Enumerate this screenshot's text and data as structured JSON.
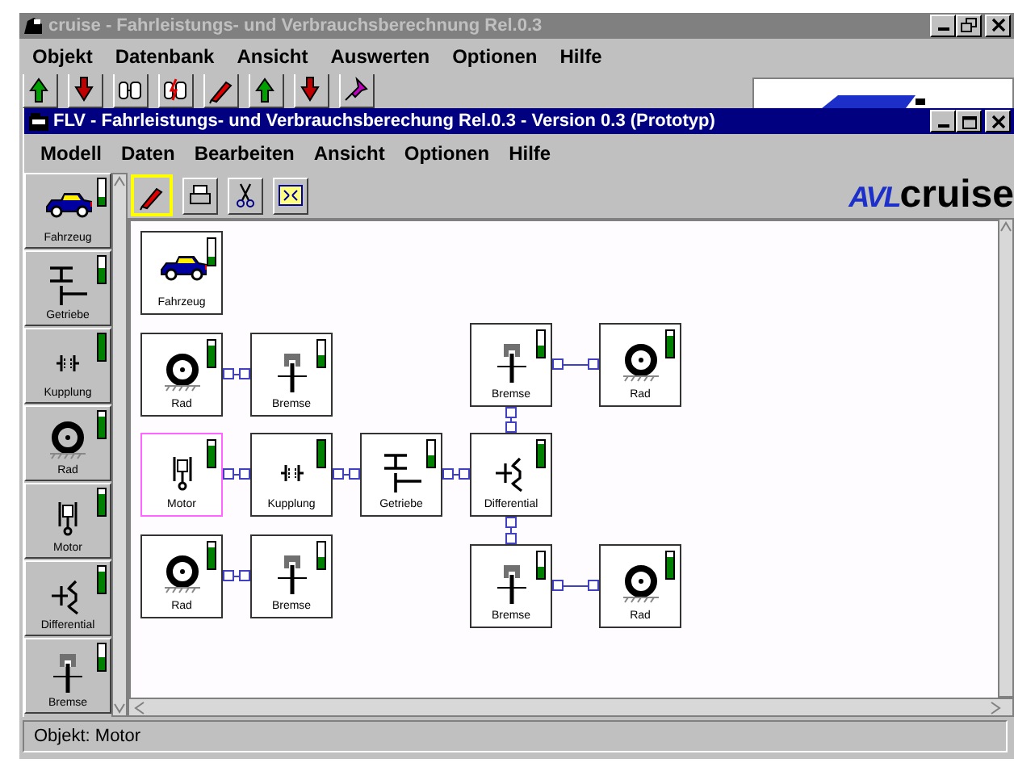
{
  "app": {
    "title": "cruise - Fahrleistungs- und Verbrauchsberechnung Rel.0.3",
    "menu": [
      "Objekt",
      "Datenbank",
      "Ansicht",
      "Auswerten",
      "Optionen",
      "Hilfe"
    ],
    "toolbar": [
      {
        "kind": "arrow-up"
      },
      {
        "kind": "arrow-down"
      },
      {
        "kind": "db"
      },
      {
        "kind": "db-flash"
      },
      {
        "kind": "pen"
      },
      {
        "kind": "arrow-up"
      },
      {
        "kind": "arrow-down"
      },
      {
        "kind": "pin"
      }
    ]
  },
  "document": {
    "title": "FLV - Fahrleistungs- und Verbrauchsberechung Rel.0.3 - Version 0.3 (Prototyp)",
    "menu": [
      "Modell",
      "Daten",
      "Bearbeiten",
      "Ansicht",
      "Optionen",
      "Hilfe"
    ],
    "palette": [
      {
        "label": "Fahrzeug",
        "kind": "vehicle",
        "level": 0.3
      },
      {
        "label": "Getriebe",
        "kind": "gearbox",
        "level": 0.6
      },
      {
        "label": "Kupplung",
        "kind": "clutch",
        "level": 1
      },
      {
        "label": "Rad",
        "kind": "wheel",
        "level": 0.85
      },
      {
        "label": "Motor",
        "kind": "engine",
        "level": 0.85
      },
      {
        "label": "Differential",
        "kind": "differential",
        "level": 0.85
      },
      {
        "label": "Bremse",
        "kind": "brake",
        "level": 0.5
      }
    ],
    "tools": [
      {
        "kind": "pen",
        "selected": true
      },
      {
        "kind": "printer",
        "selected": false
      },
      {
        "kind": "scissors",
        "selected": false
      },
      {
        "kind": "fit",
        "selected": false
      }
    ],
    "logo": {
      "mark": "AVL",
      "text": "cruise"
    },
    "model": {
      "blocks": [
        {
          "label": "Fahrzeug",
          "kind": "vehicle",
          "level": 0.35,
          "selected": false
        },
        {
          "label": "Rad",
          "kind": "wheel",
          "level": 0.85,
          "selected": false
        },
        {
          "label": "Bremse",
          "kind": "brake",
          "level": 0.45,
          "selected": false
        },
        {
          "label": "Bremse",
          "kind": "brake",
          "level": 0.45,
          "selected": false
        },
        {
          "label": "Rad",
          "kind": "wheel",
          "level": 0.85,
          "selected": false
        },
        {
          "label": "Motor",
          "kind": "engine",
          "level": 0.8,
          "selected": true
        },
        {
          "label": "Kupplung",
          "kind": "clutch",
          "level": 1,
          "selected": false
        },
        {
          "label": "Getriebe",
          "kind": "gearbox",
          "level": 0.45,
          "selected": false
        },
        {
          "label": "Differential",
          "kind": "differential",
          "level": 0.9,
          "selected": false
        },
        {
          "label": "Rad",
          "kind": "wheel",
          "level": 0.85,
          "selected": false
        },
        {
          "label": "Bremse",
          "kind": "brake",
          "level": 0.45,
          "selected": false
        },
        {
          "label": "Bremse",
          "kind": "brake",
          "level": 0.45,
          "selected": false
        },
        {
          "label": "Rad",
          "kind": "wheel",
          "level": 0.85,
          "selected": false
        }
      ]
    }
  },
  "status_bar": "Objekt: Motor"
}
